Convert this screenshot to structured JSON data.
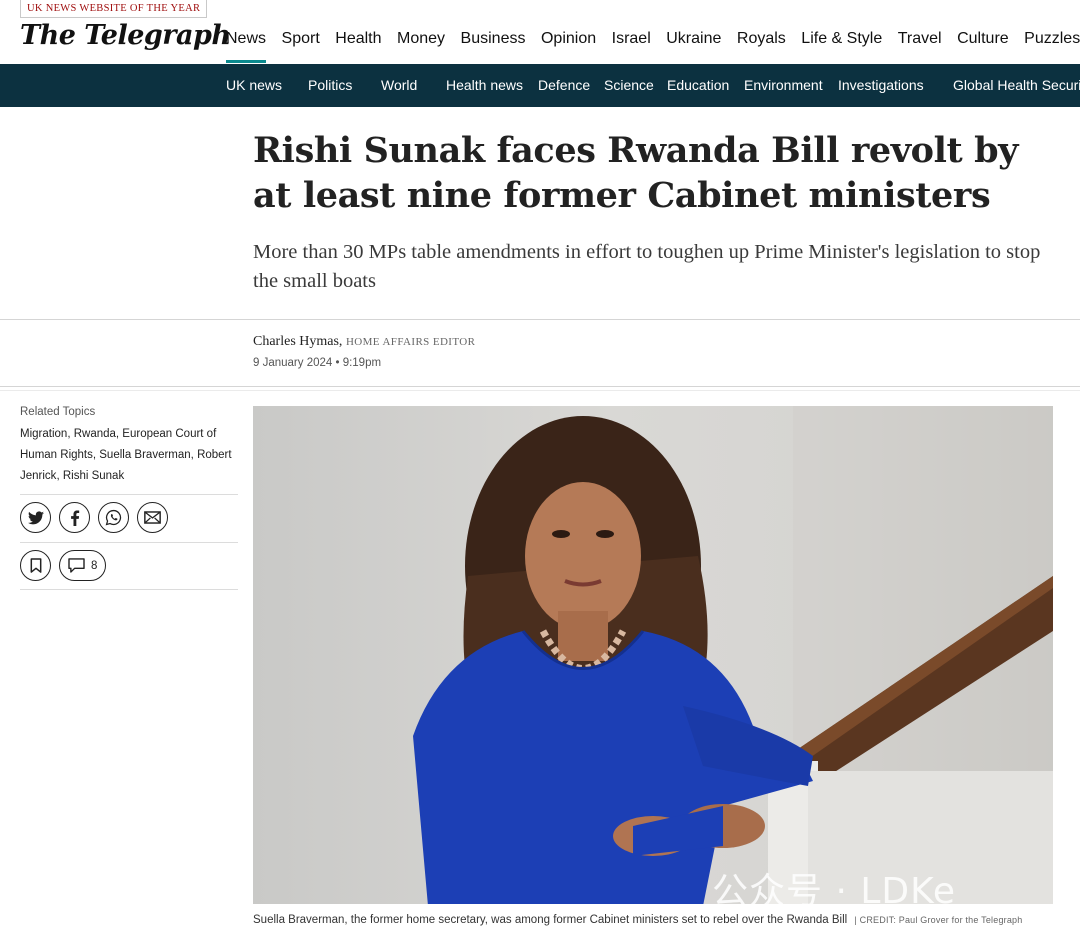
{
  "header": {
    "award": "UK NEWS WEBSITE OF THE YEAR",
    "logo": "The Telegraph",
    "nav": [
      {
        "label": "News",
        "active": true
      },
      {
        "label": "Sport"
      },
      {
        "label": "Health"
      },
      {
        "label": "Money"
      },
      {
        "label": "Business"
      },
      {
        "label": "Opinion"
      },
      {
        "label": "Israel"
      },
      {
        "label": "Ukraine"
      },
      {
        "label": "Royals"
      },
      {
        "label": "Life & Style"
      },
      {
        "label": "Travel"
      },
      {
        "label": "Culture"
      },
      {
        "label": "Puzzles"
      }
    ],
    "accent_color": "#0b8a8f"
  },
  "subnav": {
    "background": "#0c3140",
    "items": [
      "UK news",
      "Politics",
      "World",
      "Health news",
      "Defence",
      "Science",
      "Education",
      "Environment",
      "Investigations",
      "Global Health Security"
    ]
  },
  "article": {
    "headline": "Rishi Sunak faces Rwanda Bill revolt by at least nine former Cabinet ministers",
    "standfirst": "More than 30 MPs table amendments in effort to toughen up Prime Minister's legislation to stop the small boats",
    "author": "Charles Hymas,",
    "author_role": "HOME AFFAIRS EDITOR",
    "date": "9 January 2024 • 9:19pm",
    "caption": "Suella Braverman, the former home secretary, was among former Cabinet ministers set to rebel over the Rwanda Bill",
    "credit": "| CREDIT: Paul Grover for the Telegraph"
  },
  "sidebar": {
    "related_label": "Related Topics",
    "related_topics": [
      "Migration",
      "Rwanda",
      "European Court of Human Rights",
      "Suella Braverman",
      "Robert Jenrick",
      "Rishi Sunak"
    ],
    "share_icons": [
      "twitter-icon",
      "facebook-icon",
      "whatsapp-icon",
      "email-icon"
    ],
    "comment_count": "8"
  },
  "watermark": "公众号 · LDKe"
}
